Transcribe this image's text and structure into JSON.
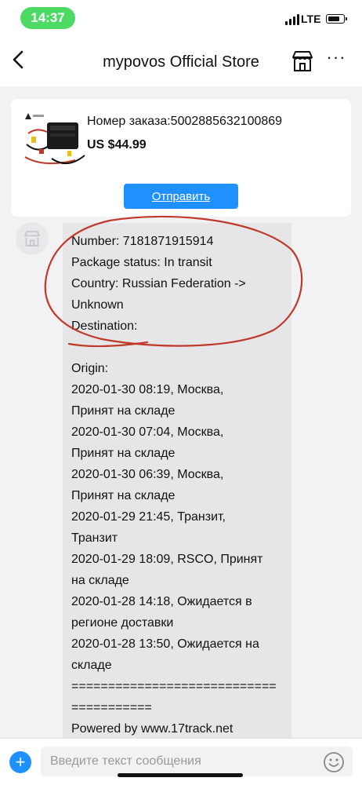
{
  "status_bar": {
    "time": "14:37",
    "network": "LTE",
    "battery_level": 0.8
  },
  "header": {
    "title": "mypovos Official Store",
    "back_icon": "chevron-left-icon",
    "store_icon": "store-icon",
    "more_icon": "more-dots-icon",
    "more_glyph": "···"
  },
  "order": {
    "number_text": "Номер заказа:5002885632100869",
    "price": "US $44.99",
    "send_label": "Отправить",
    "accent_color": "#1e90ff"
  },
  "message": {
    "lines": [
      "Number: 7181871915914",
      "Package status: In transit",
      "Country: Russian Federation ->",
      "Unknown",
      "Destination:",
      "",
      "Origin:",
      "2020-01-30 08:19, Москва,",
      "Принят на складе",
      "2020-01-30 07:04, Москва,",
      "Принят на складе",
      "2020-01-30 06:39, Москва,",
      "Принят на складе",
      "2020-01-29 21:45, Транзит,",
      "Транзит",
      "2020-01-29 18:09, RSCO, Принят",
      "на складе",
      "2020-01-28 14:18, Ожидается в",
      "регионе доставки",
      "2020-01-28 13:50, Ожидается на",
      "складе",
      "============================",
      "===========",
      "Powered by www.17track.net"
    ]
  },
  "composer": {
    "placeholder": "Введите текст сообщения",
    "add_glyph": "+",
    "emoji_icon": "smiley-icon"
  }
}
